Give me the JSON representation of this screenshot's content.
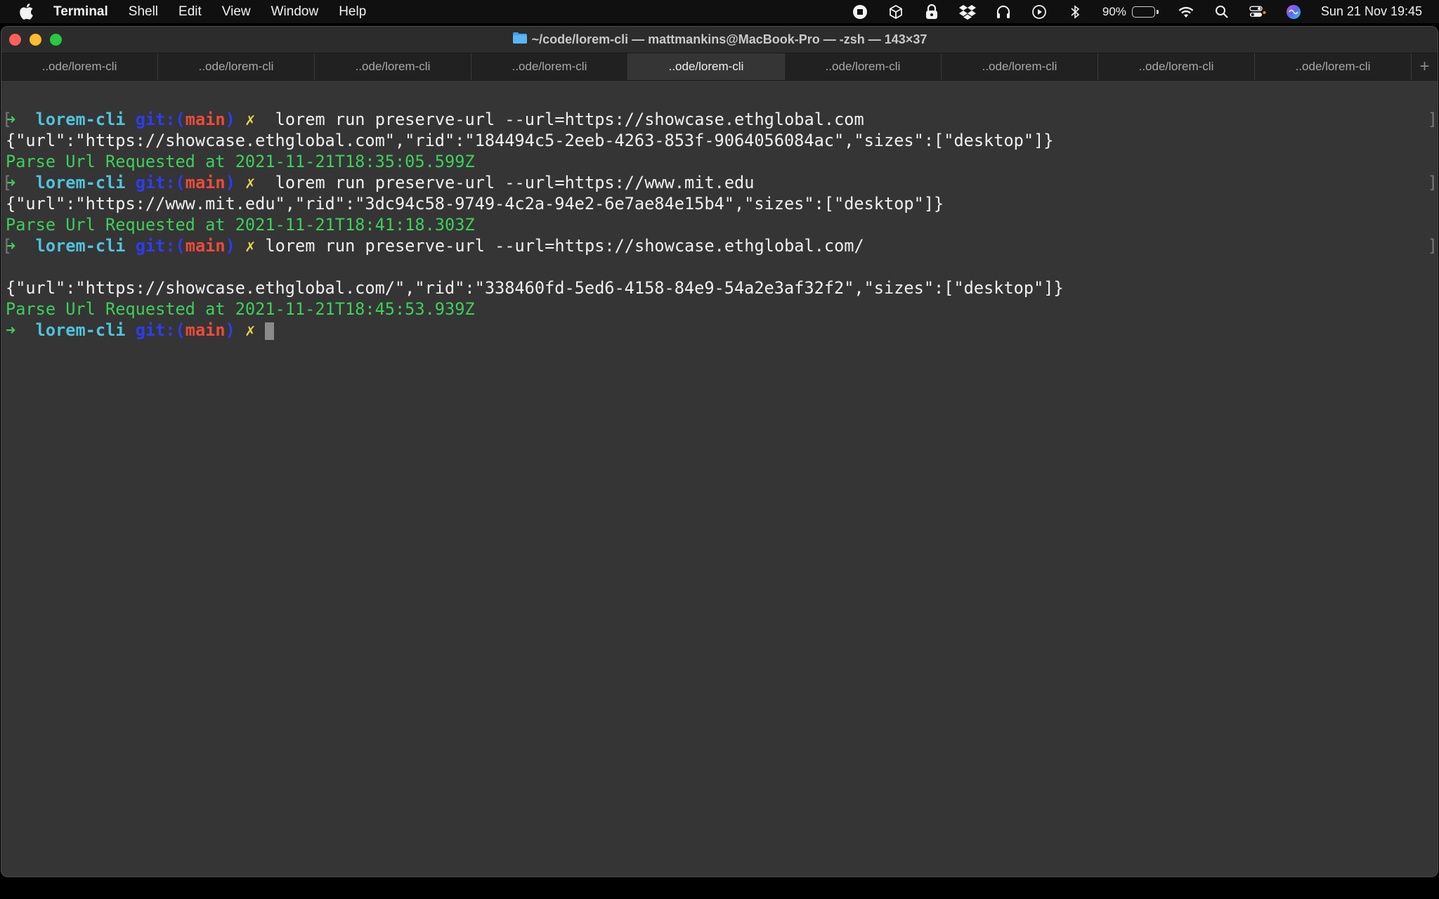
{
  "menubar": {
    "app_name": "Terminal",
    "menus": [
      "Shell",
      "Edit",
      "View",
      "Window",
      "Help"
    ],
    "battery_percent": "90%",
    "battery_level": 0.9,
    "datetime": "Sun 21 Nov  19:45"
  },
  "window": {
    "title": "~/code/lorem-cli — mattmankins@MacBook-Pro — -zsh — 143×37",
    "tabs": [
      {
        "label": "..ode/lorem-cli"
      },
      {
        "label": "..ode/lorem-cli"
      },
      {
        "label": "..ode/lorem-cli"
      },
      {
        "label": "..ode/lorem-cli"
      },
      {
        "label": "..ode/lorem-cli"
      },
      {
        "label": "..ode/lorem-cli"
      },
      {
        "label": "..ode/lorem-cli"
      },
      {
        "label": "..ode/lorem-cli"
      },
      {
        "label": "..ode/lorem-cli"
      }
    ],
    "active_tab": 4,
    "add_tab": "+"
  },
  "prompt": {
    "arrow": "➜",
    "dir": "lorem-cli",
    "git_open": "git:(",
    "branch": "main",
    "git_close": ")",
    "dirty": "✗"
  },
  "terminal": {
    "cmd1": " lorem run preserve-url --url=https://showcase.ethglobal.com",
    "out1": "{\"url\":\"https://showcase.ethglobal.com\",\"rid\":\"184494c5-2eeb-4263-853f-9064056084ac\",\"sizes\":[\"desktop\"]}",
    "log1": "Parse Url Requested at 2021-11-21T18:35:05.599Z",
    "cmd2": " lorem run preserve-url --url=https://www.mit.edu",
    "out2": "{\"url\":\"https://www.mit.edu\",\"rid\":\"3dc94c58-9749-4c2a-94e2-6e7ae84e15b4\",\"sizes\":[\"desktop\"]}",
    "log2": "Parse Url Requested at 2021-11-21T18:41:18.303Z",
    "cmd3": "lorem run preserve-url --url=https://showcase.ethglobal.com/",
    "out3": "{\"url\":\"https://showcase.ethglobal.com/\",\"rid\":\"338460fd-5ed6-4158-84e9-54a2e3af32f2\",\"sizes\":[\"desktop\"]}",
    "log3": "Parse Url Requested at 2021-11-21T18:45:53.939Z",
    "bracket_open": "[",
    "bracket_close": "]"
  },
  "colors": {
    "prompt_arrow": "#3dd05a",
    "dir": "#4fc3dc",
    "git": "#2d3cf2",
    "branch": "#ee4b3a",
    "dirty": "#e6d645",
    "log": "#3dd05a",
    "background": "#353535"
  },
  "icons": {
    "apple": "apple-icon",
    "status": [
      "record-icon",
      "box-icon",
      "keychain-icon",
      "dropbox-icon",
      "headphones-icon",
      "play-icon",
      "bluetooth-icon",
      "battery-icon",
      "wifi-icon",
      "search-icon",
      "control-center-icon",
      "siri-icon"
    ],
    "title": "folder-icon"
  }
}
